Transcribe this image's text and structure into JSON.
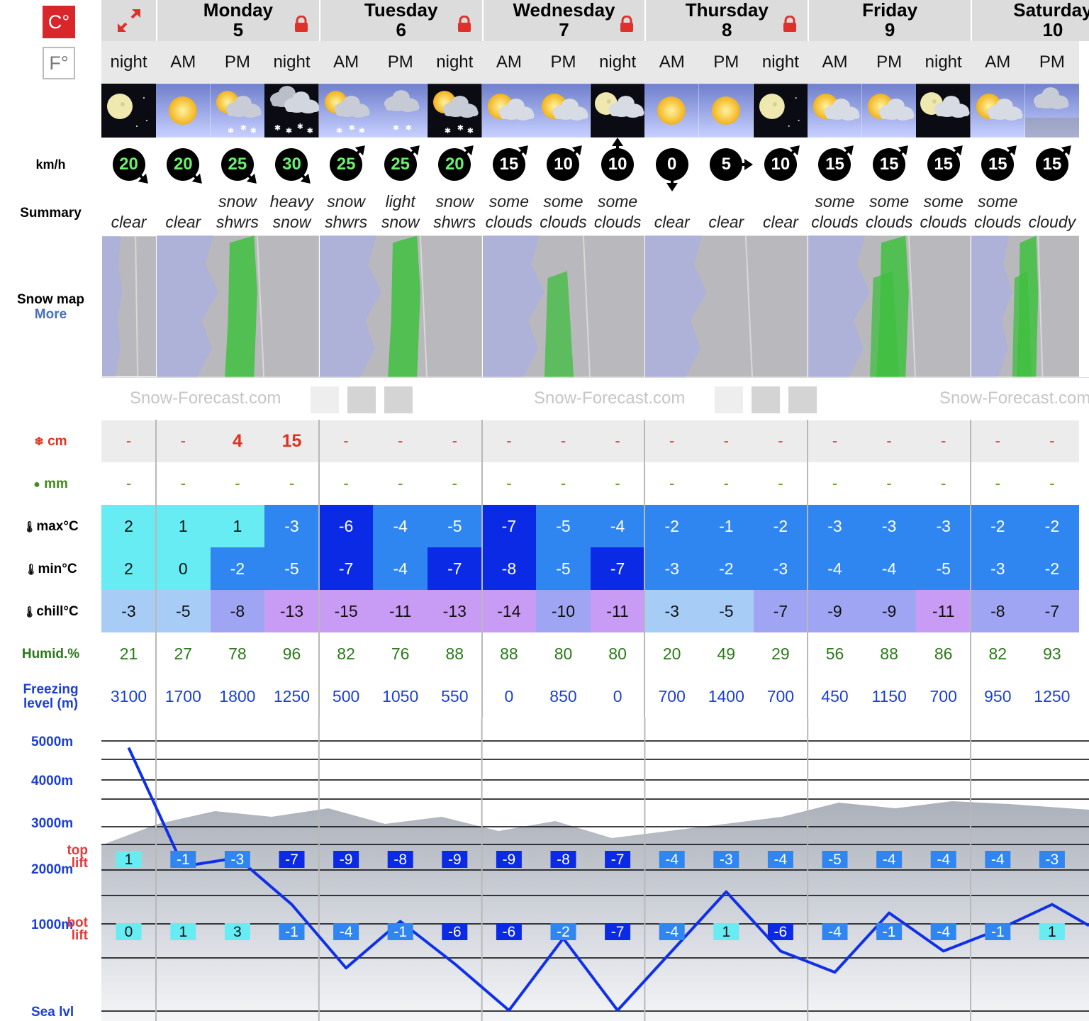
{
  "units": {
    "celsius": "C°",
    "fahrenheit": "F°"
  },
  "labels": {
    "wind": "km/h",
    "summary": "Summary",
    "snow_map": "Snow map",
    "more": "More",
    "snow": "cm",
    "rain": "mm",
    "max": "max°C",
    "min": "min°C",
    "chill": "chill°C",
    "humid": "Humid.%",
    "freezing_1": "Freezing",
    "freezing_2": "level (m)",
    "sea": "Sea lvl",
    "top": "top",
    "lift": "lift",
    "bot": "bot"
  },
  "levels": [
    "5000m",
    "4000m",
    "3000m",
    "2000m",
    "1000m"
  ],
  "watermark": "Snow-Forecast.com",
  "days": [
    {
      "name": "Monday",
      "num": "5"
    },
    {
      "name": "Tuesday",
      "num": "6"
    },
    {
      "name": "Wednesday",
      "num": "7"
    },
    {
      "name": "Thursday",
      "num": "8"
    },
    {
      "name": "Friday",
      "num": "9"
    },
    {
      "name": "Saturday",
      "num": "10"
    }
  ],
  "colors": {
    "cyan": "#66ecf2",
    "blue": "#2f86f0",
    "dark": "#0a2ae6",
    "lightblue": "#a7cdf7",
    "periwinkle": "#9fa5f2",
    "violet": "#c89cf5",
    "line": "#1030e8"
  },
  "periods": [
    {
      "p": "night",
      "icon": "moon",
      "wind": "20",
      "green": true,
      "dir": "se",
      "s": [
        "",
        "clear"
      ],
      "snow": "-",
      "rain": "-",
      "max": "2",
      "maxc": "cyan",
      "min": "2",
      "minc": "cyan",
      "chill": "-3",
      "chillc": "lightblue",
      "hum": "21",
      "frz": "3100",
      "top": "1",
      "topc": "cyan",
      "bot": "0",
      "botc": "cyan"
    },
    {
      "p": "AM",
      "icon": "sun",
      "wind": "20",
      "green": true,
      "dir": "se",
      "s": [
        "",
        "clear"
      ],
      "snow": "-",
      "rain": "-",
      "max": "1",
      "maxc": "cyan",
      "min": "0",
      "minc": "cyan",
      "chill": "-5",
      "chillc": "lightblue",
      "hum": "27",
      "frz": "1700",
      "top": "-1",
      "topc": "blue",
      "bot": "1",
      "botc": "cyan"
    },
    {
      "p": "PM",
      "icon": "sun-snow",
      "wind": "25",
      "green": true,
      "dir": "se",
      "s": [
        "snow",
        "shwrs"
      ],
      "snow": "4",
      "rain": "-",
      "max": "1",
      "maxc": "cyan",
      "min": "-2",
      "minc": "blue",
      "chill": "-8",
      "chillc": "periwinkle",
      "hum": "78",
      "frz": "1800",
      "top": "-3",
      "topc": "blue",
      "bot": "3",
      "botc": "cyan"
    },
    {
      "p": "night",
      "icon": "heavy-snow",
      "wind": "30",
      "green": true,
      "dir": "se",
      "s": [
        "heavy",
        "snow"
      ],
      "snow": "15",
      "rain": "-",
      "max": "-3",
      "maxc": "blue",
      "min": "-5",
      "minc": "blue",
      "chill": "-13",
      "chillc": "violet",
      "hum": "96",
      "frz": "1250",
      "top": "-7",
      "topc": "dark",
      "bot": "-1",
      "botc": "blue"
    },
    {
      "p": "AM",
      "icon": "sun-snow",
      "wind": "25",
      "green": true,
      "dir": "ne",
      "s": [
        "snow",
        "shwrs"
      ],
      "snow": "-",
      "rain": "-",
      "max": "-6",
      "maxc": "dark",
      "min": "-7",
      "minc": "dark",
      "chill": "-15",
      "chillc": "violet",
      "hum": "82",
      "frz": "500",
      "top": "-9",
      "topc": "dark",
      "bot": "-4",
      "botc": "blue"
    },
    {
      "p": "PM",
      "icon": "cloud-snow",
      "wind": "25",
      "green": true,
      "dir": "ne",
      "s": [
        "light",
        "snow"
      ],
      "snow": "-",
      "rain": "-",
      "max": "-4",
      "maxc": "blue",
      "min": "-4",
      "minc": "blue",
      "chill": "-11",
      "chillc": "violet",
      "hum": "76",
      "frz": "1050",
      "top": "-8",
      "topc": "dark",
      "bot": "-1",
      "botc": "blue"
    },
    {
      "p": "night",
      "icon": "sun-snow",
      "wind": "20",
      "green": true,
      "dir": "ne",
      "s": [
        "snow",
        "shwrs"
      ],
      "snow": "-",
      "rain": "-",
      "max": "-5",
      "maxc": "blue",
      "min": "-7",
      "minc": "dark",
      "chill": "-13",
      "chillc": "violet",
      "hum": "88",
      "frz": "550",
      "top": "-9",
      "topc": "dark",
      "bot": "-6",
      "botc": "dark"
    },
    {
      "p": "AM",
      "icon": "sun-cloud",
      "wind": "15",
      "green": false,
      "dir": "ne",
      "s": [
        "some",
        "clouds"
      ],
      "snow": "-",
      "rain": "-",
      "max": "-7",
      "maxc": "dark",
      "min": "-8",
      "minc": "dark",
      "chill": "-14",
      "chillc": "violet",
      "hum": "88",
      "frz": "0",
      "top": "-9",
      "topc": "dark",
      "bot": "-6",
      "botc": "dark"
    },
    {
      "p": "PM",
      "icon": "sun-cloud",
      "wind": "10",
      "green": false,
      "dir": "ne",
      "s": [
        "some",
        "clouds"
      ],
      "snow": "-",
      "rain": "-",
      "max": "-5",
      "maxc": "blue",
      "min": "-5",
      "minc": "blue",
      "chill": "-10",
      "chillc": "periwinkle",
      "hum": "80",
      "frz": "850",
      "top": "-8",
      "topc": "dark",
      "bot": "-2",
      "botc": "blue"
    },
    {
      "p": "night",
      "icon": "moon-cloud",
      "wind": "10",
      "green": false,
      "dir": "n",
      "s": [
        "some",
        "clouds"
      ],
      "snow": "-",
      "rain": "-",
      "max": "-4",
      "maxc": "blue",
      "min": "-7",
      "minc": "dark",
      "chill": "-11",
      "chillc": "violet",
      "hum": "80",
      "frz": "0",
      "top": "-7",
      "topc": "dark",
      "bot": "-7",
      "botc": "dark"
    },
    {
      "p": "AM",
      "icon": "sun",
      "wind": "0",
      "green": false,
      "dir": "s",
      "s": [
        "",
        "clear"
      ],
      "snow": "-",
      "rain": "-",
      "max": "-2",
      "maxc": "blue",
      "min": "-3",
      "minc": "blue",
      "chill": "-3",
      "chillc": "lightblue",
      "hum": "20",
      "frz": "700",
      "top": "-4",
      "topc": "blue",
      "bot": "-4",
      "botc": "blue"
    },
    {
      "p": "PM",
      "icon": "sun",
      "wind": "5",
      "green": false,
      "dir": "e",
      "s": [
        "",
        "clear"
      ],
      "snow": "-",
      "rain": "-",
      "max": "-1",
      "maxc": "blue",
      "min": "-2",
      "minc": "blue",
      "chill": "-5",
      "chillc": "lightblue",
      "hum": "49",
      "frz": "1400",
      "top": "-3",
      "topc": "blue",
      "bot": "1",
      "botc": "cyan"
    },
    {
      "p": "night",
      "icon": "moon",
      "wind": "10",
      "green": false,
      "dir": "ne",
      "s": [
        "",
        "clear"
      ],
      "snow": "-",
      "rain": "-",
      "max": "-2",
      "maxc": "blue",
      "min": "-3",
      "minc": "blue",
      "chill": "-7",
      "chillc": "periwinkle",
      "hum": "29",
      "frz": "700",
      "top": "-4",
      "topc": "blue",
      "bot": "-6",
      "botc": "dark"
    },
    {
      "p": "AM",
      "icon": "sun-cloud",
      "wind": "15",
      "green": false,
      "dir": "ne",
      "s": [
        "some",
        "clouds"
      ],
      "snow": "-",
      "rain": "-",
      "max": "-3",
      "maxc": "blue",
      "min": "-4",
      "minc": "blue",
      "chill": "-9",
      "chillc": "periwinkle",
      "hum": "56",
      "frz": "450",
      "top": "-5",
      "topc": "blue",
      "bot": "-4",
      "botc": "blue"
    },
    {
      "p": "PM",
      "icon": "sun-cloud",
      "wind": "15",
      "green": false,
      "dir": "ne",
      "s": [
        "some",
        "clouds"
      ],
      "snow": "-",
      "rain": "-",
      "max": "-3",
      "maxc": "blue",
      "min": "-4",
      "minc": "blue",
      "chill": "-9",
      "chillc": "periwinkle",
      "hum": "88",
      "frz": "1150",
      "top": "-4",
      "topc": "blue",
      "bot": "-1",
      "botc": "blue"
    },
    {
      "p": "night",
      "icon": "moon-cloud",
      "wind": "15",
      "green": false,
      "dir": "ne",
      "s": [
        "some",
        "clouds"
      ],
      "snow": "-",
      "rain": "-",
      "max": "-3",
      "maxc": "blue",
      "min": "-5",
      "minc": "blue",
      "chill": "-11",
      "chillc": "violet",
      "hum": "86",
      "frz": "700",
      "top": "-4",
      "topc": "blue",
      "bot": "-4",
      "botc": "blue"
    },
    {
      "p": "AM",
      "icon": "sun-cloud",
      "wind": "15",
      "green": false,
      "dir": "ne",
      "s": [
        "some",
        "clouds"
      ],
      "snow": "-",
      "rain": "-",
      "max": "-2",
      "maxc": "blue",
      "min": "-3",
      "minc": "blue",
      "chill": "-8",
      "chillc": "periwinkle",
      "hum": "82",
      "frz": "950",
      "top": "-4",
      "topc": "blue",
      "bot": "-1",
      "botc": "blue"
    },
    {
      "p": "PM",
      "icon": "cloud",
      "wind": "15",
      "green": false,
      "dir": "ne",
      "s": [
        "",
        "cloudy"
      ],
      "snow": "-",
      "rain": "-",
      "max": "-2",
      "maxc": "blue",
      "min": "-2",
      "minc": "blue",
      "chill": "-7",
      "chillc": "periwinkle",
      "hum": "93",
      "frz": "1250",
      "top": "-3",
      "topc": "blue",
      "bot": "1",
      "botc": "cyan"
    }
  ]
}
